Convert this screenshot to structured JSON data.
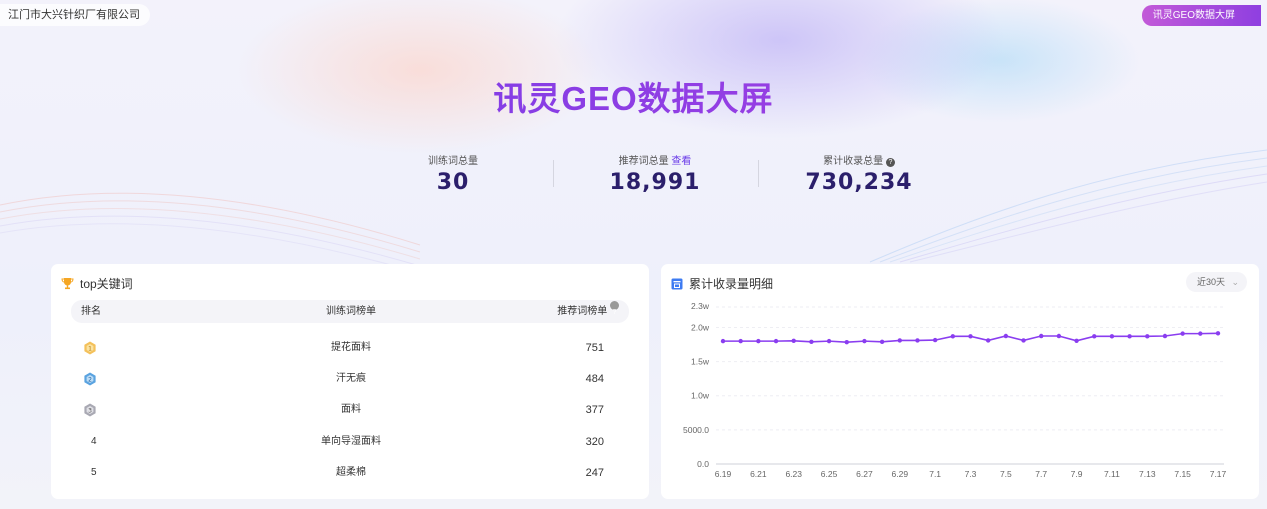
{
  "company": "江门市大兴针织厂有限公司",
  "top_button": "讯灵GEO数据大屏",
  "title": "讯灵GEO数据大屏",
  "stats": {
    "training": {
      "label": "训练词总量",
      "value": "30"
    },
    "recommend": {
      "label": "推荐词总量",
      "link": "查看",
      "value": "18,991"
    },
    "cumulative": {
      "label": "累计收录总量",
      "value": "730,234"
    }
  },
  "left_card": {
    "title": "top关键词",
    "headers": {
      "rank": "排名",
      "word": "训练词榜单",
      "num": "推荐词榜单"
    },
    "rows": [
      {
        "rank": "1",
        "word": "提花面料",
        "num": "751"
      },
      {
        "rank": "2",
        "word": "汗无痕",
        "num": "484"
      },
      {
        "rank": "3",
        "word": "面料",
        "num": "377"
      },
      {
        "rank": "4",
        "word": "单向导湿面料",
        "num": "320"
      },
      {
        "rank": "5",
        "word": "超柔棉",
        "num": "247"
      }
    ]
  },
  "right_card": {
    "title": "累计收录量明细",
    "range_select": "近30天"
  },
  "colors": {
    "accent": "#7b3fe4",
    "title_start": "#6a3ce8",
    "title_end": "#b13fe0",
    "line": "#8a3df0"
  },
  "chart_data": {
    "type": "line",
    "x": [
      "6.19",
      "6.20",
      "6.21",
      "6.22",
      "6.23",
      "6.24",
      "6.25",
      "6.26",
      "6.27",
      "6.28",
      "6.29",
      "6.30",
      "7.1",
      "7.2",
      "7.3",
      "7.4",
      "7.5",
      "7.6",
      "7.7",
      "7.8",
      "7.9",
      "7.10",
      "7.11",
      "7.12",
      "7.13",
      "7.14",
      "7.15",
      "7.16",
      "7.17"
    ],
    "x_tick_labels": [
      "6.19",
      "6.21",
      "6.23",
      "6.25",
      "6.27",
      "6.29",
      "7.1",
      "7.3",
      "7.5",
      "7.7",
      "7.9",
      "7.11",
      "7.13",
      "7.15",
      "7.17"
    ],
    "y_tick_labels": [
      "0.0",
      "5000.0",
      "1.0w",
      "1.5w",
      "2.0w",
      "2.3w"
    ],
    "y_ticks": [
      0,
      5000,
      10000,
      15000,
      20000,
      23000
    ],
    "ylim": [
      0,
      23000
    ],
    "values": [
      18000,
      18000,
      18000,
      18000,
      18050,
      17900,
      18000,
      17850,
      18000,
      17900,
      18100,
      18100,
      18150,
      18700,
      18700,
      18100,
      18750,
      18100,
      18750,
      18750,
      18050,
      18700,
      18700,
      18700,
      18700,
      18750,
      19100,
      19100,
      19150
    ],
    "grid": true
  }
}
